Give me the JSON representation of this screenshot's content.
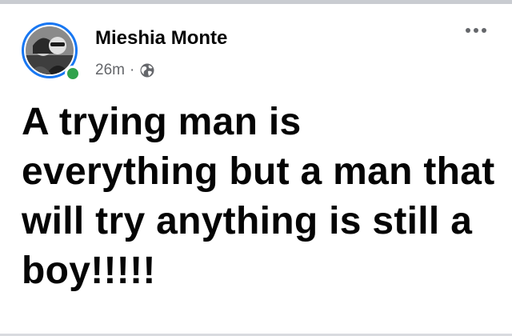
{
  "post": {
    "author": "Mieshia Monte",
    "timestamp": "26m",
    "separator": "·",
    "privacy_icon": "globe-icon",
    "more_icon": "more-options-icon",
    "text": "A trying man is everything but a man that will try anything is still a boy!!!!!"
  },
  "colors": {
    "ring": "#1877f2",
    "online": "#31a24c",
    "meta": "#65676b",
    "text": "#050505"
  }
}
